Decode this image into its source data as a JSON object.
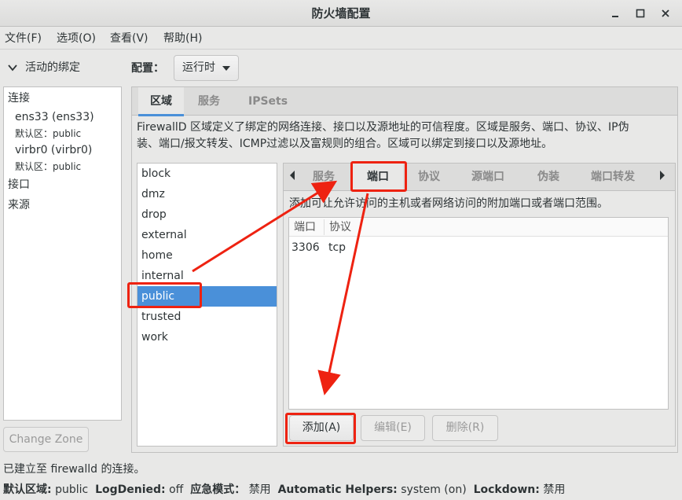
{
  "window": {
    "title": "防火墙配置"
  },
  "menu": [
    "文件(F)",
    "选项(O)",
    "查看(V)",
    "帮助(H)"
  ],
  "left": {
    "header": "活动的绑定",
    "connections_label": "连接",
    "connections": [
      {
        "name": "ens33 (ens33)",
        "zone_label": "默认区：",
        "zone": "public"
      },
      {
        "name": "virbr0 (virbr0)",
        "zone_label": "默认区：",
        "zone": "public"
      }
    ],
    "interfaces_label": "接口",
    "sources_label": "来源",
    "change_zone": "Change Zone"
  },
  "config": {
    "label": "配置：",
    "value": "运行时"
  },
  "main_tabs": [
    "区域",
    "服务",
    "IPSets"
  ],
  "description_line1": "FirewallD 区域定义了绑定的网络连接、接口以及源地址的可信程度。区域是服务、端口、协议、IP伪",
  "description_line2": "装、端口/报文转发、ICMP过滤以及富规则的组合。区域可以绑定到接口以及源地址。",
  "zones": [
    "block",
    "dmz",
    "drop",
    "external",
    "home",
    "internal",
    "public",
    "trusted",
    "work"
  ],
  "selected_zone": "public",
  "inner_tabs": [
    "服务",
    "端口",
    "协议",
    "源端口",
    "伪装",
    "端口转发"
  ],
  "port_description": "添加可让允许访问的主机或者网络访问的附加端口或者端口范围。",
  "port_table": {
    "headers": [
      "端口",
      "协议"
    ],
    "rows": [
      {
        "port": "3306",
        "protocol": "tcp"
      }
    ]
  },
  "buttons": {
    "add": "添加(A)",
    "edit": "编辑(E)",
    "remove": "删除(R)"
  },
  "status": {
    "line1": "已建立至  firewalld 的连接。",
    "default_zone_label": "默认区域:",
    "default_zone": "public",
    "log_denied_label": "LogDenied:",
    "log_denied": "off",
    "panic_label": "应急模式：",
    "panic": "禁用",
    "helpers_label": "Automatic Helpers:",
    "helpers": "system (on)",
    "lockdown_label": "Lockdown:",
    "lockdown": "禁用"
  },
  "colors": {
    "selection": "#4a90d9",
    "annotation": "#ee2211"
  }
}
